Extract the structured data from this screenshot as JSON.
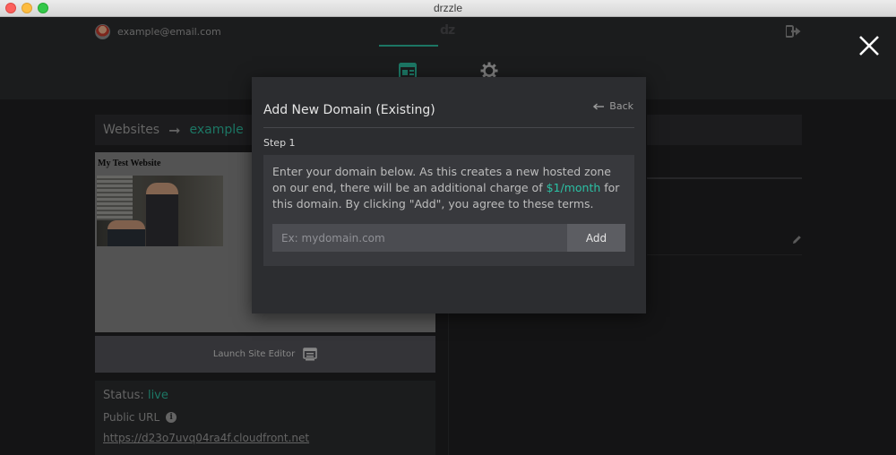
{
  "window": {
    "title": "drzzle"
  },
  "header": {
    "user_email": "example@email.com",
    "logo": "dz"
  },
  "breadcrumb": {
    "root": "Websites",
    "arrow": "➞",
    "current": "example"
  },
  "preview": {
    "site_title": "My Test Website"
  },
  "launch": {
    "label": "Launch Site Editor"
  },
  "status": {
    "label": "Status:",
    "value": "live",
    "public_url_label": "Public URL",
    "public_url": "https://d23o7uvq04ra4f.cloudfront.net"
  },
  "modal": {
    "title": "Add New Domain (Existing)",
    "back_label": "Back",
    "step_label": "Step 1",
    "instructions_before": "Enter your domain below. As this creates a new hosted zone on our end, there will be an additional charge of ",
    "price": "$1/month",
    "instructions_after": " for this domain. By clicking \"Add\", you agree to these terms.",
    "input_placeholder": "Ex: mydomain.com",
    "add_label": "Add"
  },
  "colors": {
    "accent": "#2bb59a",
    "background": "#1f1f21",
    "modal_bg": "#2c2d30"
  },
  "icons": [
    "logout-icon",
    "website-icon",
    "settings-gear-icon",
    "close-icon",
    "edit-pencil-icon",
    "editor-icon",
    "info-icon",
    "back-arrow-icon"
  ]
}
